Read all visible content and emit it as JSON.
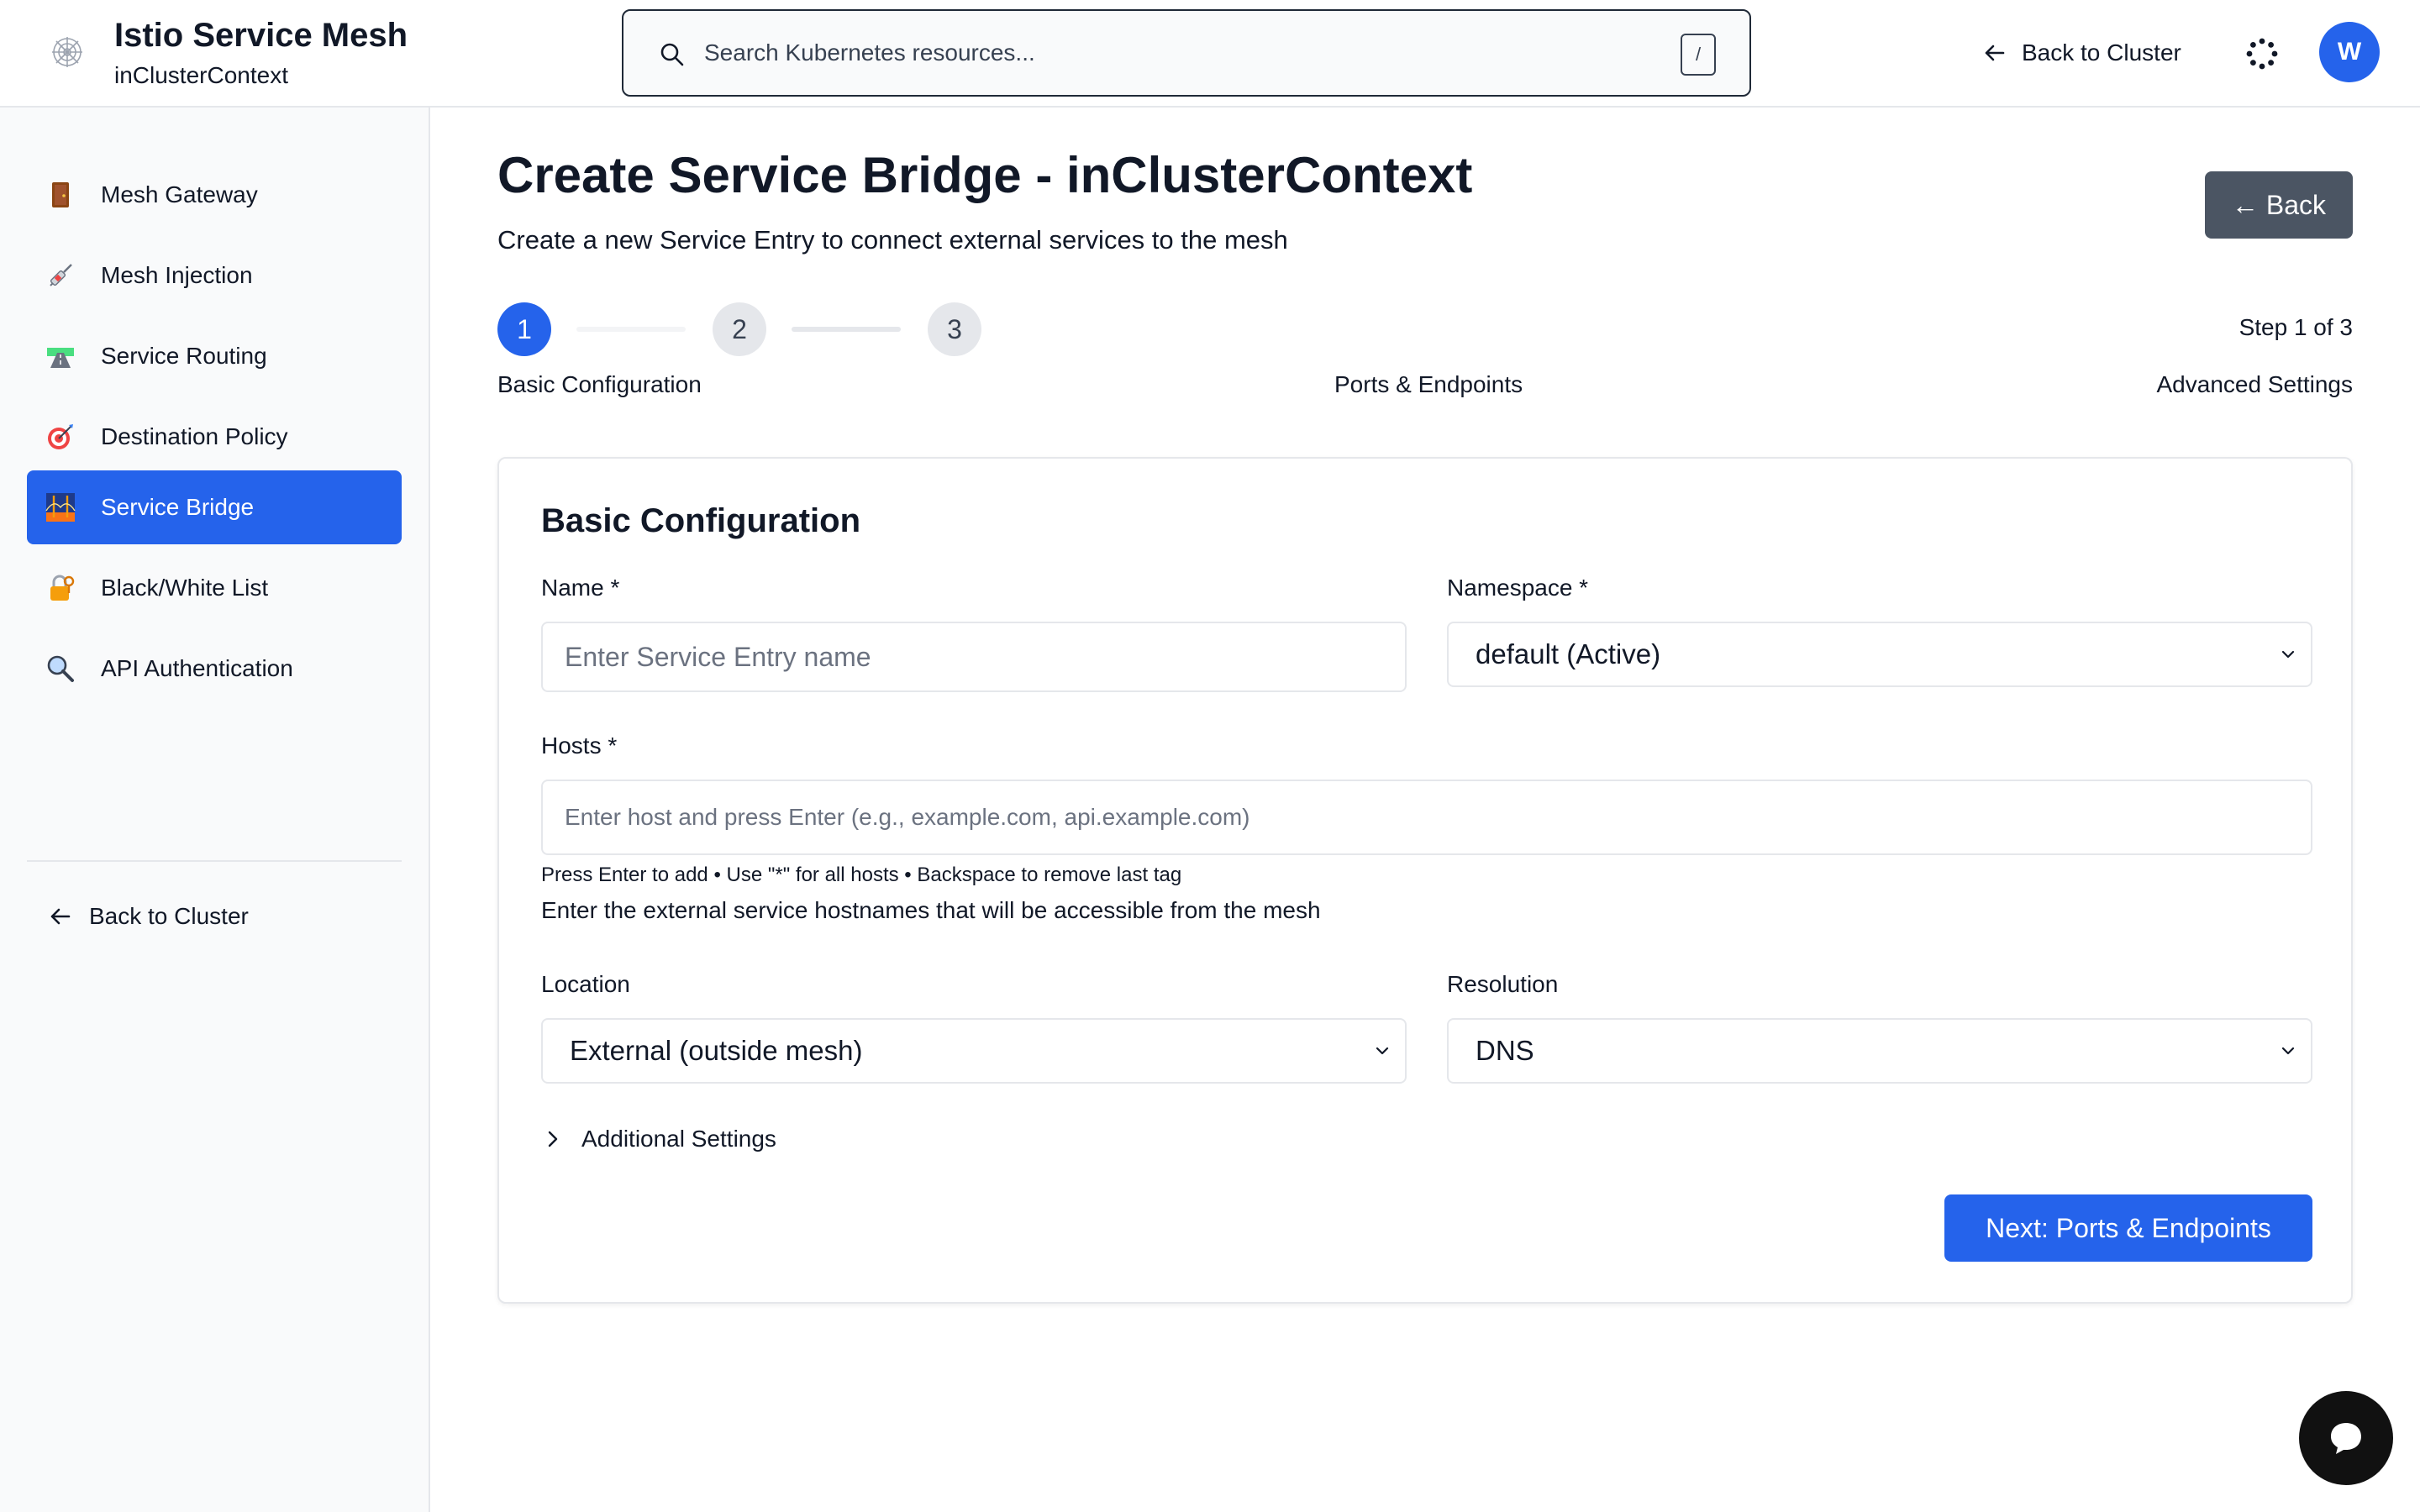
{
  "header": {
    "app_title": "Istio Service Mesh",
    "context": "inClusterContext",
    "search_placeholder": "Search Kubernetes resources...",
    "search_shortcut": "/",
    "back_to_cluster": "Back to Cluster",
    "avatar_initial": "W"
  },
  "sidebar": {
    "items": [
      {
        "label": "Mesh Gateway",
        "icon": "door-icon",
        "active": false
      },
      {
        "label": "Mesh Injection",
        "icon": "syringe-icon",
        "active": false
      },
      {
        "label": "Service Routing",
        "icon": "road-icon",
        "active": false
      },
      {
        "label": "Destination Policy",
        "icon": "target-icon",
        "active": false
      },
      {
        "label": "Service Bridge",
        "icon": "bridge-icon",
        "active": true
      },
      {
        "label": "Black/White List",
        "icon": "lock-icon",
        "active": false
      },
      {
        "label": "API Authentication",
        "icon": "magnifier-icon",
        "active": false
      }
    ],
    "back_to_cluster": "Back to Cluster"
  },
  "main": {
    "title": "Create Service Bridge - inClusterContext",
    "subtitle": "Create a new Service Entry to connect external services to the mesh",
    "back_button": "← Back",
    "stepper": {
      "steps": [
        {
          "number": "1",
          "label": "Basic Configuration",
          "status": "active"
        },
        {
          "number": "2",
          "label": "Ports & Endpoints",
          "status": "pending"
        },
        {
          "number": "3",
          "label": "Advanced Settings",
          "status": "pending"
        }
      ],
      "counter": "Step 1 of 3"
    },
    "form": {
      "section_title": "Basic Configuration",
      "name_label": "Name *",
      "name_placeholder": "Enter Service Entry name",
      "name_value": "",
      "namespace_label": "Namespace *",
      "namespace_value": "default (Active)",
      "hosts_label": "Hosts *",
      "hosts_placeholder": "Enter host and press Enter (e.g., example.com, api.example.com)",
      "hosts_hint": "Press Enter to add • Use \"*\" for all hosts • Backspace to remove last tag",
      "hosts_help": "Enter the external service hostnames that will be accessible from the mesh",
      "location_label": "Location",
      "location_value": "External (outside mesh)",
      "resolution_label": "Resolution",
      "resolution_value": "DNS",
      "additional_settings": "Additional Settings",
      "next_button": "Next: Ports & Endpoints"
    }
  },
  "colors": {
    "accent": "#2563eb",
    "back_button_bg": "#4b5563",
    "step_pending": "#e5e7eb",
    "sidebar_bg": "#f9fafb",
    "border": "#e5e7eb",
    "chat_fab": "#111111"
  }
}
